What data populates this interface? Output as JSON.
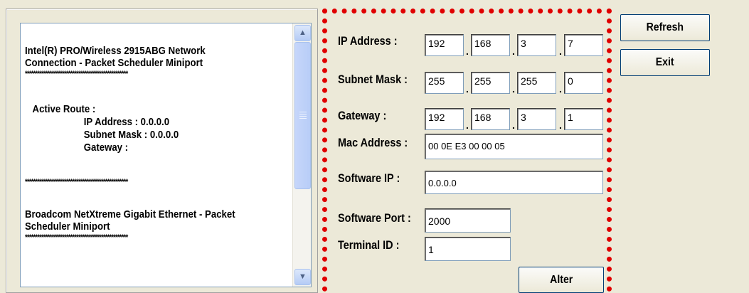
{
  "interface_list": {
    "lines": [
      "Intel(R) PRO/Wireless 2915ABG Network",
      "Connection - Packet Scheduler Miniport",
      "**************************************************",
      "Active Route :",
      "IP Address : 0.0.0.0",
      "Subnet Mask : 0.0.0.0",
      "Gateway :",
      "**************************************************",
      "Broadcom NetXtreme Gigabit Ethernet - Packet",
      "Scheduler Miniport",
      "**************************************************"
    ],
    "scroll_up_icon": "arrow-up-icon",
    "scroll_down_icon": "arrow-down-icon"
  },
  "settings": {
    "ip_label": "IP Address :",
    "ip": [
      "192",
      "168",
      "3",
      "7"
    ],
    "subnet_label": "Subnet Mask :",
    "subnet": [
      "255",
      "255",
      "255",
      "0"
    ],
    "gateway_label": "Gateway :",
    "gateway": [
      "192",
      "168",
      "3",
      "1"
    ],
    "mac_label": "Mac Address :",
    "mac": "00 0E E3 00 00 05",
    "software_ip_label": "Software IP :",
    "software_ip": "0.0.0.0",
    "software_port_label": "Software Port :",
    "software_port": "2000",
    "terminal_id_label": "Terminal ID :",
    "terminal_id": "1",
    "dot": ".",
    "alter_label": "Alter"
  },
  "buttons": {
    "refresh": "Refresh",
    "exit": "Exit"
  },
  "colors": {
    "highlight_border": "#e00000",
    "window_bg": "#ece9d8"
  }
}
